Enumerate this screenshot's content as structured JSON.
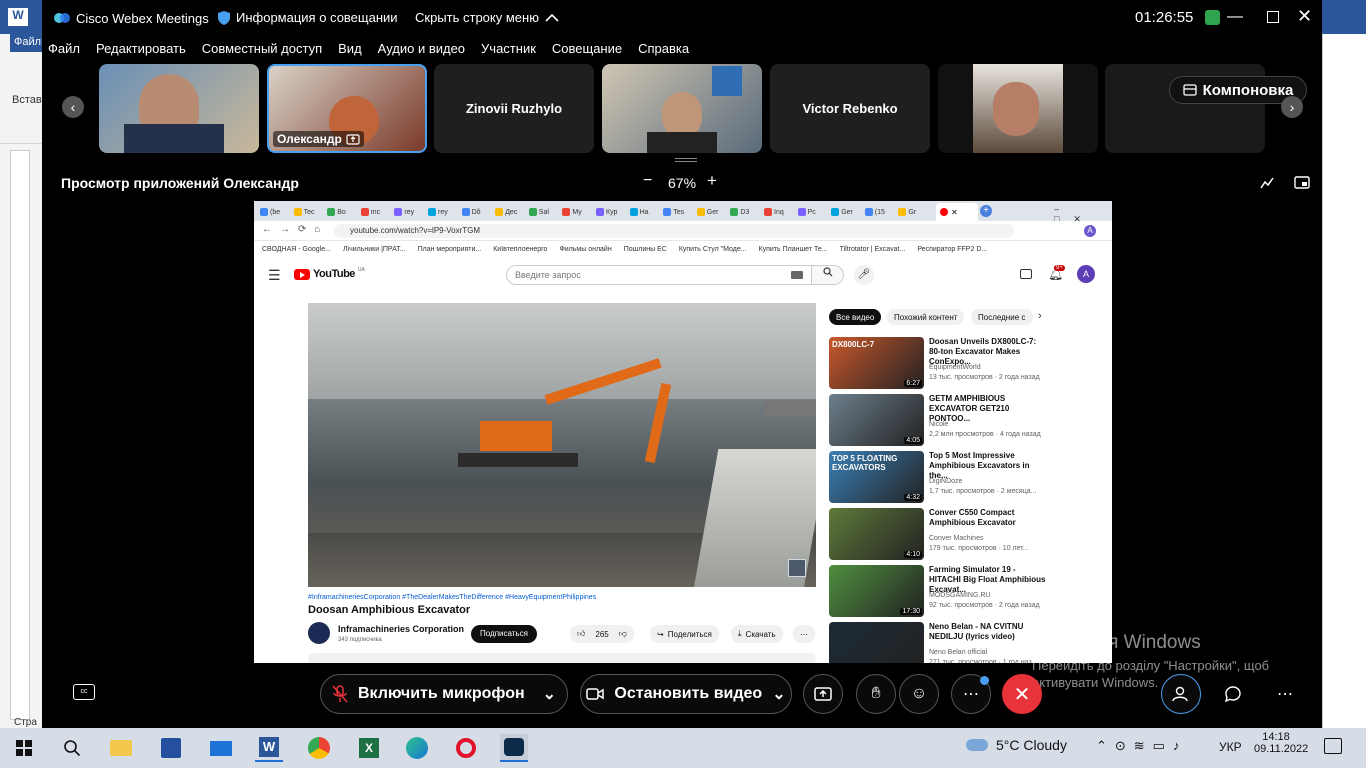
{
  "word": {
    "file_tab": "Файл",
    "paste_label": "Встав",
    "status_label": "Стра"
  },
  "window": {
    "app_title": "Cisco Webex Meetings",
    "meeting_info": "Информация о совещании",
    "hide_menu": "Скрыть строку меню",
    "clock": "01:26:55"
  },
  "menu": [
    "Файл",
    "Редактировать",
    "Совместный доступ",
    "Вид",
    "Аудио и видео",
    "Участник",
    "Совещание",
    "Справка"
  ],
  "participants": [
    {
      "name": "",
      "has_video": true
    },
    {
      "name": "Олександр",
      "has_video": true,
      "active": true
    },
    {
      "name": "Zinovii Ruzhylo",
      "has_video": false
    },
    {
      "name": "",
      "has_video": true
    },
    {
      "name": "Victor Rebenko",
      "has_video": false
    },
    {
      "name": "",
      "has_video": true
    },
    {
      "name": "",
      "has_video": false
    }
  ],
  "layout_button": "Компоновка",
  "share": {
    "title": "Просмотр приложений Олександр",
    "zoom": "67%",
    "zoom_minus": "−",
    "zoom_plus": "+"
  },
  "browser": {
    "url": "youtube.com/watch?v=lP9-VoxrTGM",
    "tabs": [
      "(be",
      "Tec",
      "Bo",
      "mc",
      "rey",
      "rey",
      "Dŏ",
      "Дес",
      "Sal",
      "My",
      "Кур",
      "Ha",
      "Tes",
      "Ger",
      "D3",
      "Inq",
      "Pc",
      "Ger",
      "(15",
      "Gr"
    ],
    "bookmarks": [
      "СВОДНАЯ - Google...",
      "Лічильники |ПРАТ...",
      "План мероприяти...",
      "Київтеплоенерго",
      "Фильмы онлайн",
      "Пошлины ЕС",
      "Купить Стул \"Моде...",
      "Купить Планшет Те...",
      "Tiltrotator | Excavat...",
      "Респиратор FFP2 D..."
    ]
  },
  "youtube": {
    "logo": "YouTube",
    "logo_sup": "UA",
    "search_placeholder": "Введите запрос",
    "notif_count": "9+",
    "avatar": "A",
    "hashtags": "#InframachineriesCorporation #TheDealerMakesTheDifference #HeavyEquipmentPhilippines",
    "video_title": "Doosan Amphibious Excavator",
    "channel": "Inframachineries Corporation",
    "subs": "343 подписчика",
    "subscribe": "Подписаться",
    "likes": "265",
    "share": "Поделиться",
    "download": "Скачать",
    "filters": [
      "Все видео",
      "Похожий контент",
      "Последние с"
    ],
    "suggestions": [
      {
        "title": "Doosan Unveils DX800LC-7: 80-ton Excavator Makes ConExpo...",
        "channel": "EquipmentWorld",
        "meta": "13 тыс. просмотров · 2 года назад",
        "duration": "6:27",
        "thumb_text": "DX800LC-7",
        "thumb_color": "#c9582a"
      },
      {
        "title": "GETM AMPHIBIOUS EXCAVATOR GET210 PONTOO...",
        "channel": "Nicole",
        "meta": "2,2 млн просмотров · 4 года назад",
        "duration": "4:05",
        "thumb_text": "",
        "thumb_color": "#6d7f8c"
      },
      {
        "title": "Top 5 Most Impressive Amphibious Excavators in the...",
        "channel": "DigiNDoze",
        "meta": "1,7 тыс. просмотров · 2 месяца...",
        "duration": "4:32",
        "thumb_text": "TOP 5 FLOATING EXCAVATORS",
        "thumb_color": "#3a7fb5"
      },
      {
        "title": "Conver C550 Compact Amphibious Excavator",
        "channel": "Conver Machines",
        "meta": "179 тыс. просмотров · 10 лет...",
        "duration": "4:10",
        "thumb_text": "",
        "thumb_color": "#5f7a3a"
      },
      {
        "title": "Farming Simulator 19 - HITACHI Big Float Amphibious Excavat...",
        "channel": "MODSGAMING.RU",
        "meta": "92 тыс. просмотров · 2 года назад",
        "duration": "17:30",
        "thumb_text": "",
        "thumb_color": "#4f8f3f"
      },
      {
        "title": "Neno Belan - NA CVITNU NEDILJU (lyrics video)",
        "channel": "Neno Belan official",
        "meta": "271 тыс. просмотров · 1 год наз...",
        "duration": "",
        "thumb_text": "",
        "thumb_color": "#1c2a36"
      }
    ]
  },
  "controls": {
    "mic": "Включить микрофон",
    "video": "Остановить видео"
  },
  "activation": {
    "title": "Активація Windows",
    "line1": "Перейдіть до розділу \"Настройки\", щоб",
    "line2": "активувати Windows."
  },
  "taskbar": {
    "weather": "5°C  Cloudy",
    "lang": "УКР",
    "time": "14:18",
    "date": "09.11.2022"
  },
  "colors": {
    "accent": "#4aa0f0",
    "leave": "#e8333b",
    "youtube_red": "#ff0000"
  }
}
